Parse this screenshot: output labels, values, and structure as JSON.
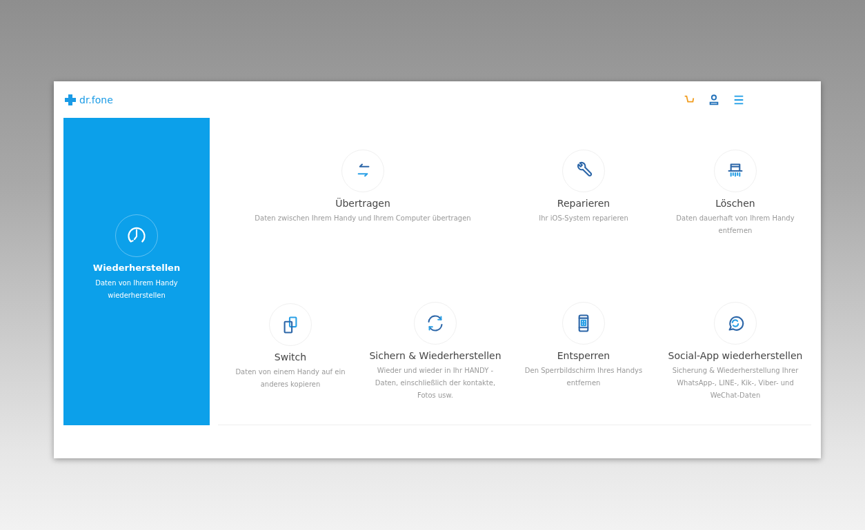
{
  "app": {
    "logo": "dr.fone"
  },
  "featured": {
    "title": "Wiederherstellen",
    "description": "Daten von Ihrem Handy wiederherstellen",
    "selected": true
  },
  "tools": [
    {
      "title": "Übertragen",
      "description": "Daten zwischen Ihrem Handy und Ihrem Computer übertragen",
      "selected": false
    },
    {
      "title": "Reparieren",
      "description": "Ihr iOS-System reparieren",
      "selected": false
    },
    {
      "title": "Löschen",
      "description": "Daten dauerhaft von Ihrem Handy entfernen",
      "selected": false
    },
    {
      "title": "Switch",
      "description": "Daten von einem Handy auf ein anderes kopieren",
      "selected": false
    },
    {
      "title": "Sichern & Wiederherstellen",
      "description": "Wieder und wieder in Ihr HANDY - Daten, einschließlich der kontakte, Fotos usw.",
      "selected": false
    },
    {
      "title": "Entsperren",
      "description": "Den Sperrbildschirm Ihres Handys entfernen",
      "selected": false
    },
    {
      "title": "Social-App wiederherstellen",
      "description": "Sicherung & Wiederherstellung Ihrer WhatsApp-, LINE-, Kik-, Viber- und WeChat-Daten",
      "selected": false
    }
  ]
}
